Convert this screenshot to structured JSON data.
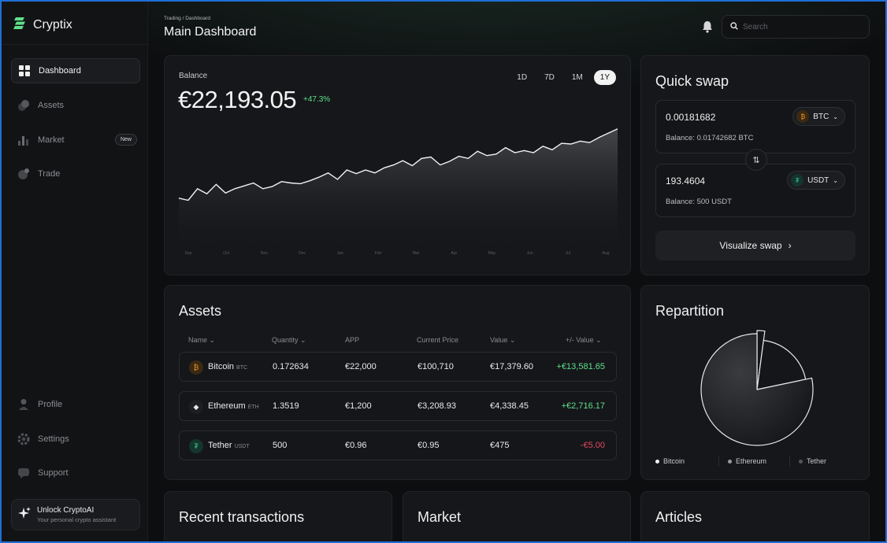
{
  "app": {
    "name": "Cryptix",
    "brand_color": "#5ee08a"
  },
  "sidebar": {
    "items": [
      {
        "label": "Dashboard",
        "icon": "grid-icon",
        "active": true
      },
      {
        "label": "Assets",
        "icon": "coins-icon"
      },
      {
        "label": "Market",
        "icon": "bar-chart-icon",
        "badge": "New"
      },
      {
        "label": "Trade",
        "icon": "trade-icon"
      }
    ],
    "bottom_items": [
      {
        "label": "Profile",
        "icon": "user-icon"
      },
      {
        "label": "Settings",
        "icon": "gear-icon"
      },
      {
        "label": "Support",
        "icon": "support-icon"
      }
    ],
    "unlock": {
      "title": "Unlock CryptoAI",
      "subtitle": "Your personal crypto assistant"
    }
  },
  "header": {
    "breadcrumb": "Trading / Dashboard",
    "title": "Main Dashboard",
    "search_placeholder": "Search"
  },
  "balance": {
    "label": "Balance",
    "value": "€22,193.05",
    "change": "+47.3%",
    "ranges": [
      "1D",
      "7D",
      "1M",
      "1Y"
    ],
    "active_range": "1Y"
  },
  "chart_data": {
    "type": "area",
    "x": [
      "Sep",
      "Oct",
      "Nov",
      "Dec",
      "Jan",
      "Feb",
      "Mar",
      "Apr",
      "May",
      "Jun",
      "Jul",
      "Aug"
    ],
    "values": [
      0.21,
      0.18,
      0.34,
      0.27,
      0.4,
      0.28,
      0.34,
      0.38,
      0.42,
      0.34,
      0.37,
      0.44,
      0.42,
      0.41,
      0.45,
      0.5,
      0.56,
      0.47,
      0.6,
      0.55,
      0.6,
      0.56,
      0.63,
      0.67,
      0.73,
      0.66,
      0.76,
      0.78,
      0.67,
      0.72,
      0.79,
      0.76,
      0.86,
      0.8,
      0.82,
      0.91,
      0.84,
      0.87,
      0.84,
      0.93,
      0.88,
      0.97,
      0.96,
      1.0,
      0.98,
      1.05,
      1.11,
      1.17
    ],
    "grid": false,
    "ylabel": "",
    "xlabel": ""
  },
  "quick_swap": {
    "title": "Quick swap",
    "from": {
      "amount": "0.00181682",
      "token": "BTC",
      "balance": "Balance: 0.01742682 BTC"
    },
    "to": {
      "amount": "193.4604",
      "token": "USDT",
      "balance": "Balance: 500 USDT"
    },
    "button": "Visualize swap"
  },
  "assets": {
    "title": "Assets",
    "columns": [
      "Name",
      "Quantity",
      "APP",
      "Current Price",
      "Value",
      "+/- Value"
    ],
    "rows": [
      {
        "name": "Bitcoin",
        "symbol": "BTC",
        "quantity": "0.172634",
        "app": "€22,000",
        "price": "€100,710",
        "value": "€17,379.60",
        "change": "+€13,581.65",
        "positive": true
      },
      {
        "name": "Ethereum",
        "symbol": "ETH",
        "quantity": "1.3519",
        "app": "€1,200",
        "price": "€3,208.93",
        "value": "€4,338.45",
        "change": "+€2,716.17",
        "positive": true
      },
      {
        "name": "Tether",
        "symbol": "USDT",
        "quantity": "500",
        "app": "€0.96",
        "price": "€0.95",
        "value": "€475",
        "change": "-€5.00",
        "positive": false
      }
    ]
  },
  "repartition": {
    "title": "Repartition",
    "slices": [
      {
        "name": "Bitcoin",
        "percent": 78.3,
        "color": "#f0f0f0"
      },
      {
        "name": "Ethereum",
        "percent": 19.6,
        "color": "#9a9a9a"
      },
      {
        "name": "Tether",
        "percent": 2.1,
        "color": "#555555"
      }
    ]
  },
  "bottom_cards": {
    "transactions": "Recent transactions",
    "market": "Market",
    "articles": "Articles"
  }
}
